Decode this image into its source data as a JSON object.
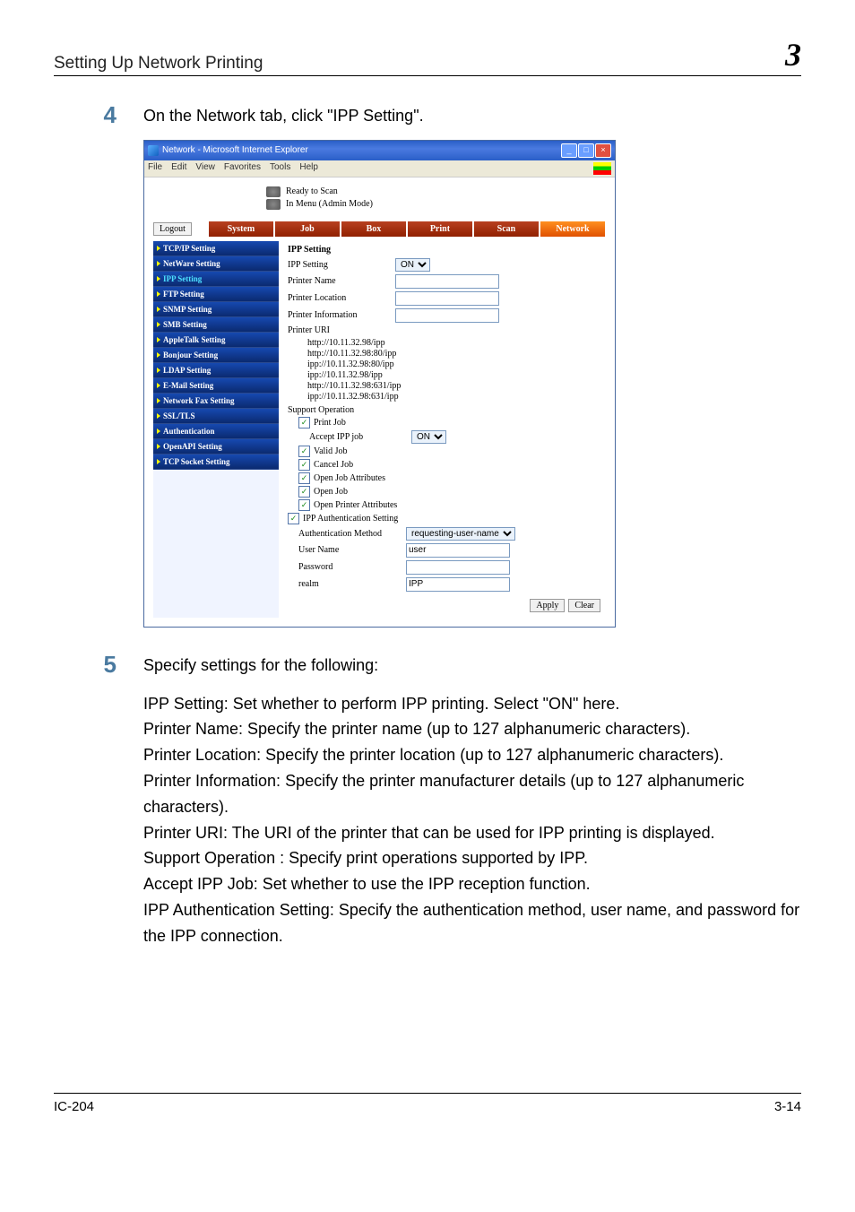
{
  "header": {
    "title": "Setting Up Network Printing",
    "chapter": "3"
  },
  "steps": {
    "s4": {
      "num": "4",
      "text": "On the Network tab, click \"IPP Setting\"."
    },
    "s5": {
      "num": "5",
      "intro": "Specify settings for the following:",
      "lines": [
        "IPP Setting: Set whether to perform IPP printing. Select \"ON\" here.",
        "Printer Name: Specify the printer name (up to 127 alphanumeric characters).",
        "Printer Location: Specify the printer location (up to 127 alphanumeric characters).",
        "Printer Information: Specify the printer manufacturer details (up to 127 alphanumeric characters).",
        "Printer URI: The URI of the printer that can be used for IPP printing is displayed.",
        "Support Operation : Specify print operations supported by IPP.",
        "Accept IPP Job: Set whether to use the IPP reception function.",
        "IPP Authentication Setting: Specify the authentication method, user name, and password for the IPP connection."
      ]
    }
  },
  "ie": {
    "title": "Network - Microsoft Internet Explorer",
    "menu": {
      "file": "File",
      "edit": "Edit",
      "view": "View",
      "favorites": "Favorites",
      "tools": "Tools",
      "help": "Help"
    },
    "status": {
      "ready": "Ready to Scan",
      "mode": "In Menu (Admin Mode)"
    },
    "logout": "Logout",
    "tabs": [
      "System",
      "Job",
      "Box",
      "Print",
      "Scan",
      "Network"
    ],
    "sidebar": [
      "TCP/IP Setting",
      "NetWare Setting",
      "IPP Setting",
      "FTP Setting",
      "SNMP Setting",
      "SMB Setting",
      "AppleTalk Setting",
      "Bonjour Setting",
      "LDAP Setting",
      "E-Mail Setting",
      "Network Fax Setting",
      "SSL/TLS",
      "Authentication",
      "OpenAPI Setting",
      "TCP Socket Setting"
    ],
    "panel": {
      "title": "IPP Setting",
      "ipp_setting_label": "IPP Setting",
      "ipp_setting_value": "ON",
      "printer_name": "Printer Name",
      "printer_location": "Printer Location",
      "printer_info": "Printer Information",
      "printer_uri_label": "Printer URI",
      "uris": [
        "http://10.11.32.98/ipp",
        "http://10.11.32.98:80/ipp",
        "ipp://10.11.32.98:80/ipp",
        "ipp://10.11.32.98/ipp",
        "http://10.11.32.98:631/ipp",
        "ipp://10.11.32.98:631/ipp"
      ],
      "support_op": "Support Operation",
      "chk_print_job": "Print Job",
      "accept_ipp_label": "Accept IPP job",
      "accept_ipp_value": "ON",
      "chk_valid_job": "Valid Job",
      "chk_cancel_job": "Cancel Job",
      "chk_open_job_attr": "Open Job Attributes",
      "chk_open_job": "Open Job",
      "chk_open_printer_attr": "Open Printer Attributes",
      "chk_ipp_auth": "IPP Authentication Setting",
      "auth_method_label": "Authentication Method",
      "auth_method_value": "requesting-user-name",
      "user_name_label": "User Name",
      "user_name_value": "user",
      "password_label": "Password",
      "realm_label": "realm",
      "realm_value": "IPP",
      "apply": "Apply",
      "clear": "Clear"
    }
  },
  "footer": {
    "left": "IC-204",
    "right": "3-14"
  }
}
